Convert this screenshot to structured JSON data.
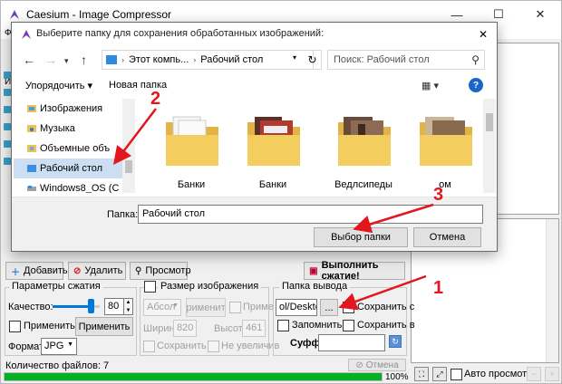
{
  "main_window": {
    "title": "Caesium - Image Compressor",
    "menu_char": "Ф",
    "left_char": "И",
    "minimize_glyph": "—",
    "maximize_glyph": "☐",
    "close_glyph": "✕"
  },
  "toolbar": {
    "add_label": "Добавить",
    "remove_label": "Удалить",
    "preview_label": "Просмотр",
    "compress_label": "Выполнить сжатие!"
  },
  "compression": {
    "group_title": "Параметры сжатия",
    "quality_label": "Качество:",
    "quality_value": "80",
    "quality_level": 0.8,
    "apply_all_label": "Применить д",
    "apply_button": "Применить",
    "format_label": "Формат",
    "format_value": "JPG"
  },
  "resize": {
    "group_title": "Размер изображения",
    "mode_value": "Абсол",
    "apply_button": "рименит",
    "apply_check_label": "Приме",
    "width_label": "Ширин",
    "width_value": "820",
    "height_label": "Высота",
    "height_value": "461",
    "keep_ratio_label": "Сохранить п",
    "no_enlarge_label": "Не увеличив"
  },
  "output": {
    "group_title": "Папка вывода",
    "path_value": "ol/Desktop",
    "browse_button": "...",
    "keep_check_label": "Сохранить с",
    "remember_label": "Запомнить п",
    "save_in_label": "Сохранить в",
    "suffix_label": "Суффикс:",
    "suffix_value": ""
  },
  "status": {
    "files_count": "Количество файлов: 7",
    "cancel_label": "Отмена",
    "progress_text": "100%",
    "progress_value": 1.0,
    "auto_preview_label": "Авто просмотр"
  },
  "dialog": {
    "title": "Выберите папку для сохранения обработанных изображений:",
    "close_glyph": "✕",
    "breadcrumb": [
      "Этот компь...",
      "Рабочий стол"
    ],
    "search_placeholder": "Поиск: Рабочий стол",
    "organize_label": "Упорядочить ▾",
    "new_folder_label": "Новая папка",
    "help_label": "?",
    "nav_items": [
      {
        "label": "Изображения"
      },
      {
        "label": "Музыка"
      },
      {
        "label": "Объемные объ"
      },
      {
        "label": "Рабочий стол"
      },
      {
        "label": "Windows8_OS (C"
      }
    ],
    "files": [
      {
        "name": "Банки"
      },
      {
        "name": "Банки"
      },
      {
        "name": "Ведлсипеды"
      },
      {
        "name": "ом"
      }
    ],
    "folder_label": "Папка:",
    "folder_value": "Рабочий стол",
    "select_button": "Выбор папки",
    "cancel_button": "Отмена"
  },
  "annotations": {
    "num1": "1",
    "num2": "2",
    "num3": "3",
    "color": "#e3161d"
  }
}
